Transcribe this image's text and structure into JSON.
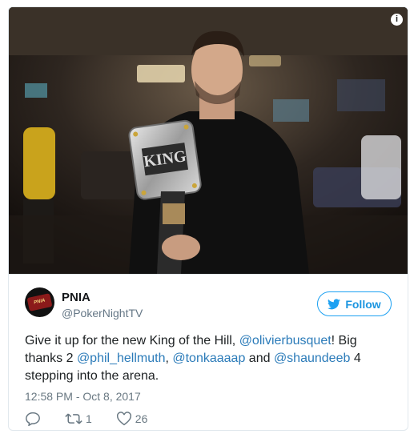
{
  "tweet": {
    "author": {
      "name": "PNIA",
      "handle": "@PokerNightTV",
      "avatar_icon": "poker-night-logo-avatar"
    },
    "follow_label": "Follow",
    "text_segments": [
      {
        "text": "Give it up for the new King of the Hill, ",
        "type": "plain"
      },
      {
        "text": "@olivierbusquet",
        "type": "mention"
      },
      {
        "text": "! Big thanks 2 ",
        "type": "plain"
      },
      {
        "text": "@phil_hellmuth",
        "type": "mention"
      },
      {
        "text": ", ",
        "type": "plain"
      },
      {
        "text": "@tonkaaaap",
        "type": "mention"
      },
      {
        "text": " and ",
        "type": "plain"
      },
      {
        "text": "@shaundeeb",
        "type": "mention"
      },
      {
        "text": " 4 stepping into the arena.",
        "type": "plain"
      }
    ],
    "timestamp": "12:58 PM - Oct 8, 2017",
    "actions": {
      "reply_icon": "reply-icon",
      "retweet_count": "1",
      "like_count": "26"
    }
  },
  "media": {
    "info_icon": "info-icon",
    "photo_description_icon": "photo-man-holding-championship-belt"
  },
  "colors": {
    "accent": "#1da1f2",
    "link": "#2b7bb9",
    "muted": "#697882",
    "text": "#1c2022"
  }
}
